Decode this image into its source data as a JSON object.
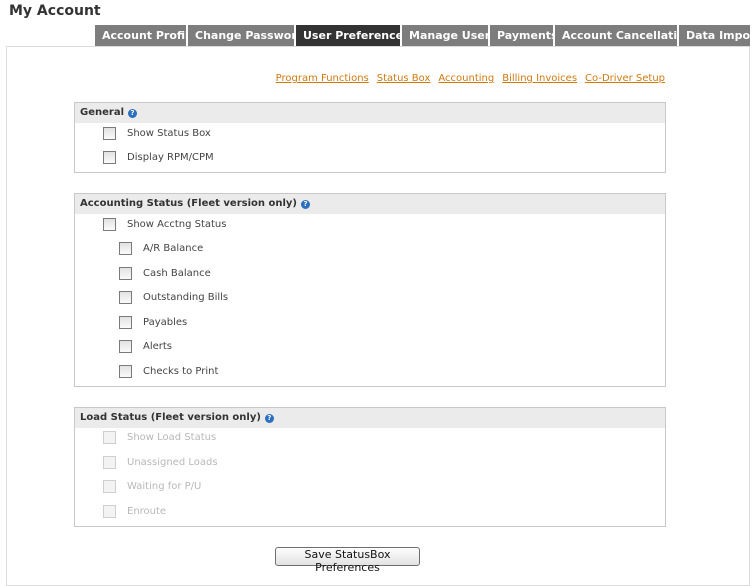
{
  "page_title": "My Account",
  "tabs": [
    {
      "label": "Account Profile"
    },
    {
      "label": "Change Password"
    },
    {
      "label": "User Preferences",
      "active": true
    },
    {
      "label": "Manage Users"
    },
    {
      "label": "Payments"
    },
    {
      "label": "Account Cancellation"
    },
    {
      "label": "Data Import"
    }
  ],
  "subnav": [
    "Program Functions",
    "Status Box",
    "Accounting",
    "Billing Invoices",
    "Co-Driver Setup"
  ],
  "colors": {
    "tab": "#7d7d7d",
    "tab_active": "#333333",
    "link": "#d07a10",
    "help": "#2a6fc0"
  },
  "general": {
    "title": "General",
    "items": [
      {
        "label": "Show Status Box",
        "checked": false
      },
      {
        "label": "Display RPM/CPM",
        "checked": false
      }
    ]
  },
  "accounting": {
    "title": "Accounting Status (Fleet version only)",
    "main": {
      "label": "Show Acctng Status",
      "checked": false
    },
    "items": [
      {
        "label": "A/R Balance",
        "checked": false
      },
      {
        "label": "Cash Balance",
        "checked": false
      },
      {
        "label": "Outstanding Bills",
        "checked": false
      },
      {
        "label": "Payables",
        "checked": false
      },
      {
        "label": "Alerts",
        "checked": false
      },
      {
        "label": "Checks to Print",
        "checked": false
      }
    ]
  },
  "load": {
    "title": "Load Status (Fleet version only)",
    "items": [
      {
        "label": "Show Load Status",
        "disabled": true
      },
      {
        "label": "Unassigned Loads",
        "disabled": true
      },
      {
        "label": "Waiting for P/U",
        "disabled": true
      },
      {
        "label": "Enroute",
        "disabled": true
      }
    ]
  },
  "save_label": "Save StatusBox Preferences"
}
